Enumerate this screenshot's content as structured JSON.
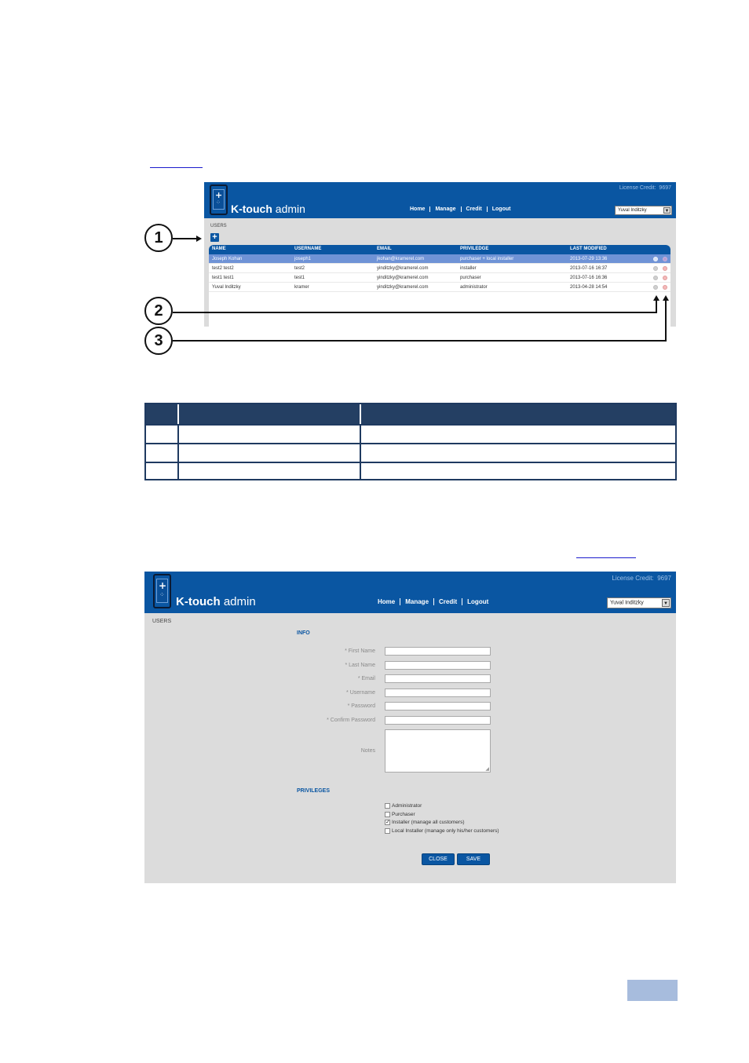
{
  "figure1": {
    "header": {
      "brand_bold": "K-touch",
      "brand_light": "admin",
      "license_label": "License Credit:",
      "license_value": "9697",
      "nav": [
        "Home",
        "Manage",
        "Credit",
        "Logout"
      ],
      "user_select": "Yuval Inditzky"
    },
    "section_label": "USERS",
    "add_button": "+",
    "table": {
      "headers": [
        "NAME",
        "USERNAME",
        "EMAIL",
        "PRIVILEDGE",
        "LAST MODIFIED"
      ],
      "rows": [
        [
          "Joseph Kohan",
          "joseph1",
          "jkohan@kramerel.com",
          "purchaser + local installer",
          "2013-07-29 13:36"
        ],
        [
          "test2 test2",
          "test2",
          "yinditzky@kramerel.com",
          "installer",
          "2013-07-16 16:37"
        ],
        [
          "test1 test1",
          "test1",
          "yinditzky@kramerel.com",
          "purchaser",
          "2013-07-16 16:36"
        ],
        [
          "Yuval Inditzky",
          "kramer",
          "yinditzky@kramerel.com",
          "administrator",
          "2013-04-28 14:54"
        ]
      ],
      "selected_row": 0
    },
    "callouts": [
      "1",
      "2",
      "3"
    ]
  },
  "figure2": {
    "header": {
      "brand_bold": "K-touch",
      "brand_light": "admin",
      "license_label": "License Credit:",
      "license_value": "9697",
      "nav": [
        "Home",
        "Manage",
        "Credit",
        "Logout"
      ],
      "user_select": "Yuval Inditzky"
    },
    "section_label": "USERS",
    "info_title": "INFO",
    "fields": [
      "* First Name",
      "* Last Name",
      "* Email",
      "* Username",
      "* Password",
      "* Confirm Password"
    ],
    "notes_label": "Notes",
    "privileges_title": "PRIVILEGES",
    "privileges": [
      {
        "label": "Administrator",
        "checked": false
      },
      {
        "label": "Purchaser",
        "checked": false
      },
      {
        "label": "Installer (manage all customers)",
        "checked": true
      },
      {
        "label": "Local Installer (manage only his/her customers)",
        "checked": false
      }
    ],
    "close_label": "CLOSE",
    "save_label": "SAVE"
  },
  "colors": {
    "header_blue": "#0a56a2",
    "body_gray": "#dcdcdc",
    "table_header_navy": "#243f63",
    "page_box": "#a7bcdd",
    "link_blue": "#1a1acc"
  }
}
